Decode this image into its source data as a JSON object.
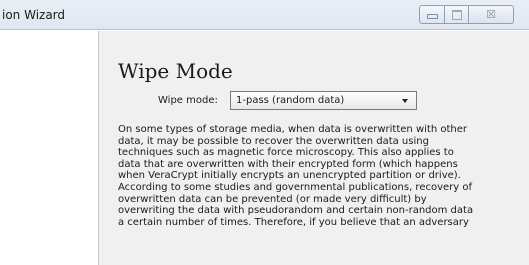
{
  "window": {
    "title": "ion Wizard",
    "controls": {
      "minimize_icon": "minimize-icon",
      "maximize_icon": "maximize-icon",
      "close_icon": "close-icon",
      "close_glyph": "☒"
    }
  },
  "page": {
    "title": "Wipe Mode",
    "wipe_mode_label": "Wipe mode:",
    "wipe_mode_value": "1-pass (random data)",
    "description": "On some types of storage media, when data is overwritten with other\ndata, it may be possible to recover the overwritten data using\ntechniques such as magnetic force microscopy. This also applies to\ndata that are overwritten with their encrypted form (which happens\nwhen VeraCrypt initially encrypts an unencrypted partition or drive).\nAccording to some studies and governmental publications, recovery of\noverwritten data can be prevented (or made very difficult) by\noverwriting the data with pseudorandom and certain non-random data\na certain number of times. Therefore, if you believe that an adversary"
  },
  "colors": {
    "content_background": "#f0f0f0",
    "titlebar_background": "#dfe7f1"
  }
}
